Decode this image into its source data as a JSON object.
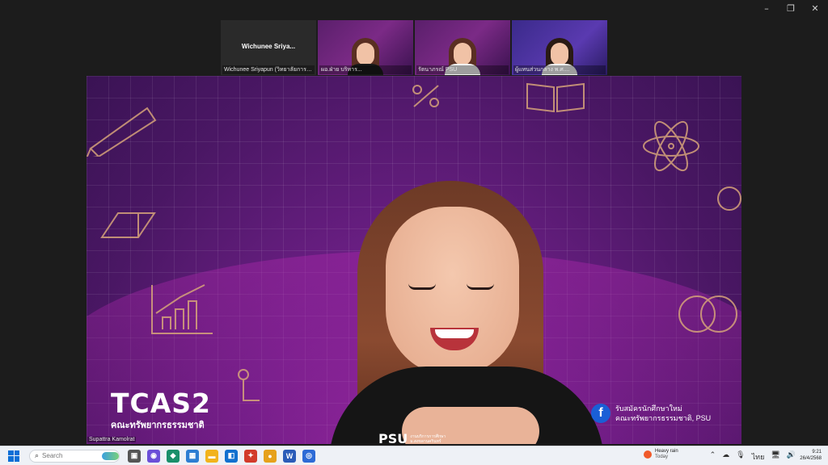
{
  "window": {
    "controls": [
      "–",
      "❐",
      "✕"
    ]
  },
  "participants": [
    {
      "display": "Wichunee Sriya...",
      "caption": "Wichunee Sriyapun (วิทยาลัยการจัดการ...)",
      "video": false
    },
    {
      "display": "",
      "caption": "ผอ.ฝ่าย บริหาร...",
      "video": true,
      "active": true
    },
    {
      "display": "",
      "caption": "รัตนาภรณ์ PSU",
      "video": true
    },
    {
      "display": "",
      "caption": "ผู้แทนส่วนกลาง พ.ศ....",
      "video": true
    }
  ],
  "self_label": "Supattra Kamolrat",
  "brand": {
    "title": "TCAS2",
    "subtitle": "คณะทรัพยากรธรรมชาติ"
  },
  "facebook": {
    "line1": "รับสมัครนักศึกษาใหม่",
    "line2": "คณะทรัพยากรธรรมชาติ, PSU"
  },
  "watermark": {
    "mark": "PSU",
    "sub1": "งานบริการการศึกษา",
    "sub2": "ม.สงขลานครินทร์"
  },
  "taskbar": {
    "search_placeholder": "Search",
    "weather_line1": "Heavy rain",
    "weather_line2": "Today",
    "time": "9:21",
    "date": "26/4/2568",
    "tray_icons": [
      "⌃",
      "☁",
      "🎙",
      "ไทย",
      "🖥",
      "🔊"
    ]
  },
  "colors": {
    "accent": "#2fd16a",
    "brand_purple": "#6d1f86",
    "facebook": "#1a5fd6"
  }
}
